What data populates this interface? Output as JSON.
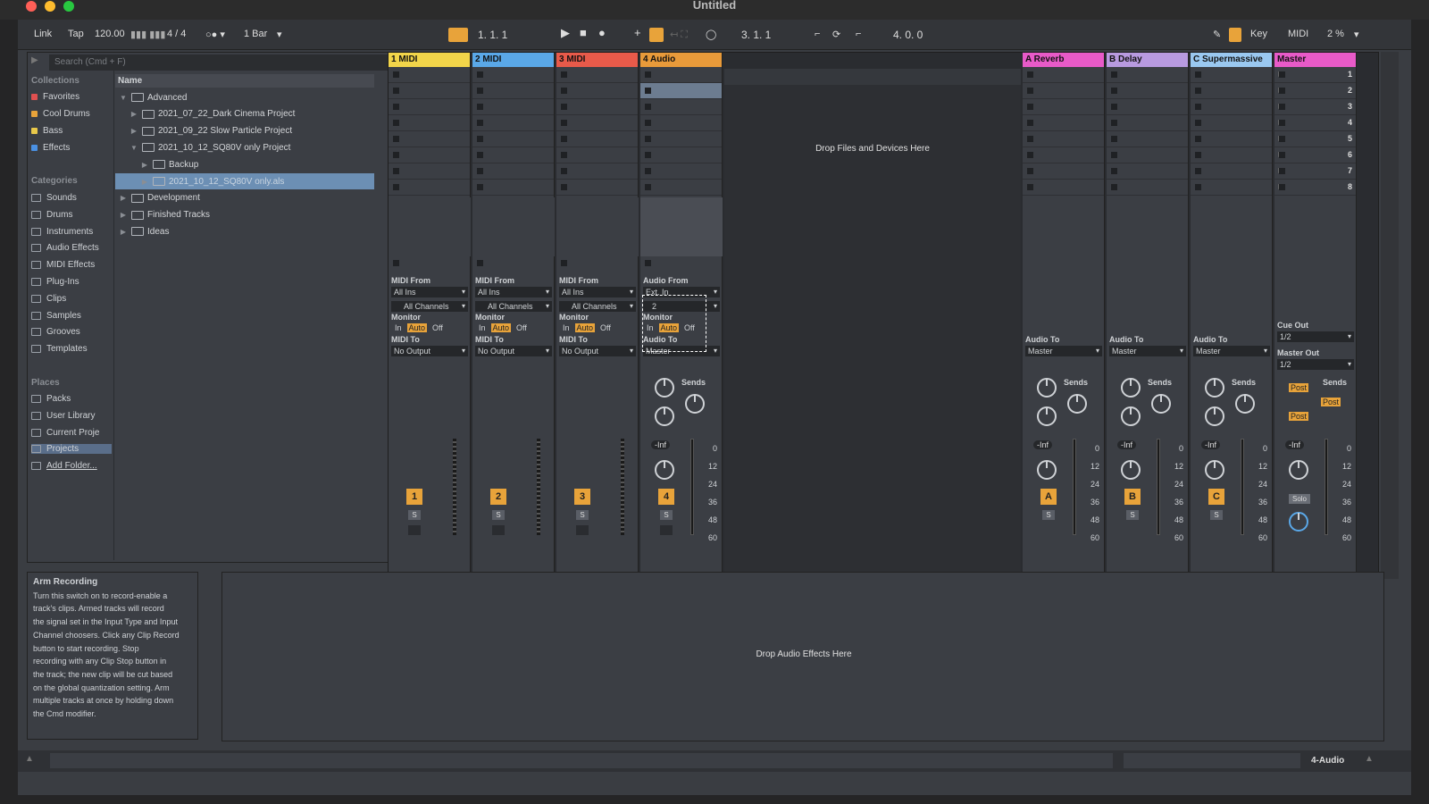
{
  "window": {
    "title": "Untitled"
  },
  "control_bar": {
    "link": "Link",
    "tap": "Tap",
    "tempo": "120.00",
    "signature": "4 / 4",
    "quantize": "1 Bar",
    "position": "1.   1.   1",
    "loop_start": "3.   1.   1",
    "loop_length": "4.   0.   0",
    "key": "Key",
    "midi": "MIDI",
    "cpu": "2 %"
  },
  "browser": {
    "search_placeholder": "Search (Cmd + F)",
    "collections_label": "Collections",
    "collections": [
      {
        "label": "Favorites",
        "color": "#e05050"
      },
      {
        "label": "Cool Drums",
        "color": "#e8a33a"
      },
      {
        "label": "Bass",
        "color": "#e8c84a"
      },
      {
        "label": "Effects",
        "color": "#4a90e2"
      }
    ],
    "categories_label": "Categories",
    "categories": [
      "Sounds",
      "Drums",
      "Instruments",
      "Audio Effects",
      "MIDI Effects",
      "Plug-Ins",
      "Clips",
      "Samples",
      "Grooves",
      "Templates"
    ],
    "places_label": "Places",
    "places": [
      "Packs",
      "User Library",
      "Current Proje",
      "Projects",
      "Add Folder..."
    ],
    "name_header": "Name",
    "files": [
      {
        "label": "Advanced",
        "indent": 0,
        "tri": "▼"
      },
      {
        "label": "2021_07_22_Dark Cinema Project",
        "indent": 1,
        "tri": "▶"
      },
      {
        "label": "2021_09_22 Slow Particle Project",
        "indent": 1,
        "tri": "▶"
      },
      {
        "label": "2021_10_12_SQ80V only Project",
        "indent": 1,
        "tri": "▼"
      },
      {
        "label": "Backup",
        "indent": 2,
        "tri": "▶"
      },
      {
        "label": "2021_10_12_SQ80V only.als",
        "indent": 2,
        "tri": "▶",
        "selected": true
      },
      {
        "label": "Development",
        "indent": 0,
        "tri": "▶"
      },
      {
        "label": "Finished Tracks",
        "indent": 0,
        "tri": "▶"
      },
      {
        "label": "Ideas",
        "indent": 0,
        "tri": "▶"
      }
    ]
  },
  "info": {
    "title": "Arm Recording",
    "lines": [
      "Turn this switch on to record-enable a",
      "track's clips. Armed tracks will record",
      "the signal set in the Input Type and Input",
      "Channel choosers. Click any Clip Record",
      "button to start recording. Stop",
      "recording with any Clip Stop button in",
      "the track; the new clip will be cut based",
      "on the global quantization setting. Arm",
      "multiple tracks at once by holding down",
      "the Cmd modifier."
    ]
  },
  "tracks": [
    {
      "name": "1 MIDI",
      "color": "#f2d54a",
      "from_label": "MIDI From",
      "from": "All Ins",
      "channel": "All Channels",
      "monitor_label": "Monitor",
      "mon": [
        "In",
        "Auto",
        "Off"
      ],
      "to_label": "MIDI To",
      "to": "No Output",
      "num": "1"
    },
    {
      "name": "2 MIDI",
      "color": "#5aa8e8",
      "from_label": "MIDI From",
      "from": "All Ins",
      "channel": "All Channels",
      "monitor_label": "Monitor",
      "mon": [
        "In",
        "Auto",
        "Off"
      ],
      "to_label": "MIDI To",
      "to": "No Output",
      "num": "2"
    },
    {
      "name": "3 MIDI",
      "color": "#e85a4a",
      "from_label": "MIDI From",
      "from": "All Ins",
      "channel": "All Channels",
      "monitor_label": "Monitor",
      "mon": [
        "In",
        "Auto",
        "Off"
      ],
      "to_label": "MIDI To",
      "to": "No Output",
      "num": "3"
    },
    {
      "name": "4 Audio",
      "color": "#e89a3a",
      "from_label": "Audio From",
      "from": "Ext. In",
      "channel": "2",
      "monitor_label": "Monitor",
      "mon": [
        "In",
        "Auto",
        "Off"
      ],
      "to_label": "Audio To",
      "to": "Master",
      "num": "4",
      "vol": "-Inf",
      "sends": "Sends"
    }
  ],
  "returns": [
    {
      "name": "A Reverb",
      "color": "#e85ac8",
      "to_label": "Audio To",
      "to": "Master",
      "letter": "A",
      "vol": "-Inf",
      "sends": "Sends"
    },
    {
      "name": "B Delay",
      "color": "#b89ae0",
      "to_label": "Audio To",
      "to": "Master",
      "letter": "B",
      "vol": "-Inf",
      "sends": "Sends"
    },
    {
      "name": "C Supermassive",
      "color": "#9ac8f0",
      "to_label": "Audio To",
      "to": "Master",
      "letter": "C",
      "vol": "-Inf",
      "sends": "Sends"
    }
  ],
  "master": {
    "name": "Master",
    "color": "#e85ac8",
    "cue_label": "Cue Out",
    "cue": "1/2",
    "out_label": "Master Out",
    "out": "1/2",
    "vol": "-Inf",
    "sends": "Sends",
    "post": "Post",
    "solo": "Solo",
    "scenes": [
      "1",
      "2",
      "3",
      "4",
      "5",
      "6",
      "7",
      "8"
    ]
  },
  "meter_scale": [
    "0",
    "12",
    "24",
    "36",
    "48",
    "60"
  ],
  "drop_files": "Drop Files and Devices Here",
  "drop_effects": "Drop Audio Effects Here",
  "status_track": "4-Audio"
}
